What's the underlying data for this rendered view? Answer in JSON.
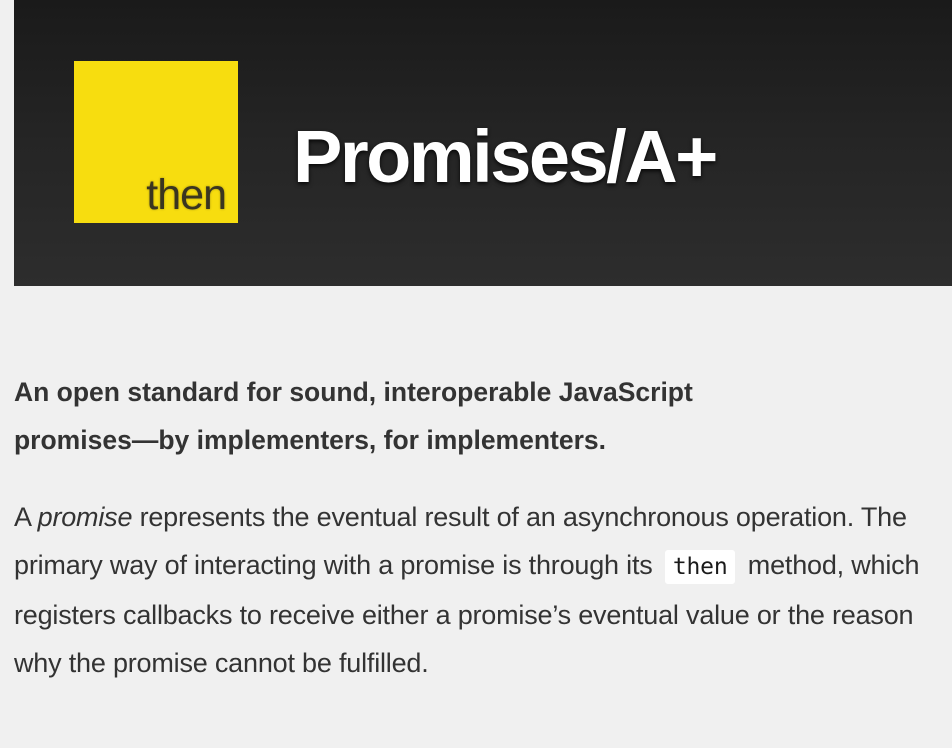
{
  "header": {
    "logo_text": "then",
    "title": "Promises/A+",
    "logo_color": "#f7dd0f",
    "background_color": "#2a2a2a"
  },
  "tagline": {
    "line1": "An open standard for sound, interoperable JavaScript",
    "line2": "promises—by implementers, for implementers."
  },
  "intro": {
    "part1": "A ",
    "term": "promise",
    "part2": " represents the eventual result of an asynchronous operation. The primary way of interacting with a promise is through its",
    "code": "then",
    "part3": "method, which registers callbacks to receive either a promise’s eventual value or the reason why the promise cannot be fulfilled."
  }
}
